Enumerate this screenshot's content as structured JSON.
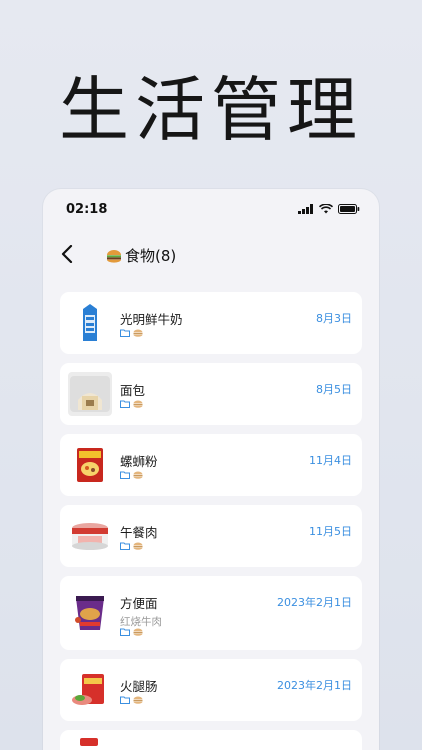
{
  "hero": {
    "title": "生活管理"
  },
  "status": {
    "time": "02:18"
  },
  "nav": {
    "emoji": "🍔",
    "title": "食物(8)"
  },
  "items": [
    {
      "name": "光明鲜牛奶",
      "date": "8月3日",
      "sub": "",
      "thumb": "milk-carton-image"
    },
    {
      "name": "面包",
      "date": "8月5日",
      "sub": "",
      "thumb": "bread-bag-image"
    },
    {
      "name": "螺蛳粉",
      "date": "11月4日",
      "sub": "",
      "thumb": "noodle-pack-image"
    },
    {
      "name": "午餐肉",
      "date": "11月5日",
      "sub": "",
      "thumb": "luncheon-meat-can-image"
    },
    {
      "name": "方便面",
      "date": "2023年2月1日",
      "sub": "红烧牛肉",
      "thumb": "instant-noodle-cup-image"
    },
    {
      "name": "火腿肠",
      "date": "2023年2月1日",
      "sub": "",
      "thumb": "ham-sausage-image"
    }
  ],
  "colors": {
    "accent": "#3b8fe0",
    "background": "#f3f3f7"
  }
}
